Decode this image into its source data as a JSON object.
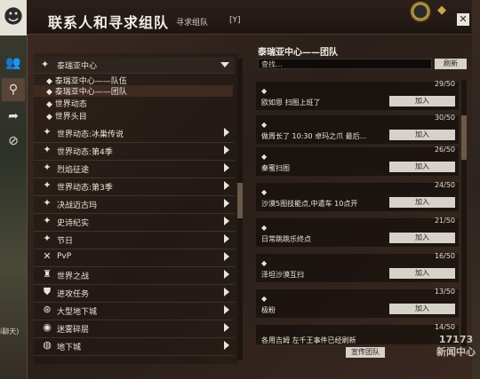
{
  "header": {
    "title": "联系人和寻求组队",
    "tab": "寻求组队",
    "shortcut": "[Y]",
    "close": "✕"
  },
  "side_text": "i聊天)",
  "nav": {
    "groups": [
      {
        "label": "泰瑞亚中心",
        "icon": "star-icon",
        "expanded": true
      },
      {
        "label": "世界动态:冰巢传说",
        "icon": "star-icon"
      },
      {
        "label": "世界动态:第4季",
        "icon": "star-icon"
      },
      {
        "label": "烈焰征途",
        "icon": "star-icon"
      },
      {
        "label": "世界动态:第3季",
        "icon": "star-icon"
      },
      {
        "label": "决战迈古玛",
        "icon": "star-icon"
      },
      {
        "label": "史诗纪实",
        "icon": "star-icon"
      },
      {
        "label": "节日",
        "icon": "star-icon"
      },
      {
        "label": "PvP",
        "icon": "swords-icon"
      },
      {
        "label": "世界之战",
        "icon": "castle-icon"
      },
      {
        "label": "进攻任务",
        "icon": "shield-icon"
      },
      {
        "label": "大型地下城",
        "icon": "dungeon-icon"
      },
      {
        "label": "迷雾碎层",
        "icon": "fractal-icon"
      },
      {
        "label": "地下城",
        "icon": "gate-icon"
      }
    ],
    "subitems": [
      {
        "label": "泰瑞亚中心——队伍"
      },
      {
        "label": "泰瑞亚中心——团队",
        "selected": true
      },
      {
        "label": "世界动态"
      },
      {
        "label": "世界头目"
      }
    ]
  },
  "detail": {
    "title": "泰瑞亚中心——团队",
    "search_placeholder": "查找...",
    "refresh": "刷新",
    "join": "加入",
    "post": "宣传团队",
    "listings": [
      {
        "count": "29/50",
        "desc": "欧如恩  扫图上班了"
      },
      {
        "count": "30/50",
        "desc": "做周长了  10:30  卓玛之爪    最后..."
      },
      {
        "count": "26/50",
        "desc": "秦蜜扫图"
      },
      {
        "count": "24/50",
        "desc": "沙漠5图技能点,中遣车     10点开"
      },
      {
        "count": "21/50",
        "desc": "日常跳跳乐终点"
      },
      {
        "count": "16/50",
        "desc": "泽坦沙漠互扫"
      },
      {
        "count": "13/50",
        "desc": "极粉"
      },
      {
        "count": "14/50",
        "desc": "各用吉姆  左千王事件已经刷新"
      }
    ]
  },
  "watermark": {
    "line1": "17173",
    "line2": "新闻中心"
  }
}
